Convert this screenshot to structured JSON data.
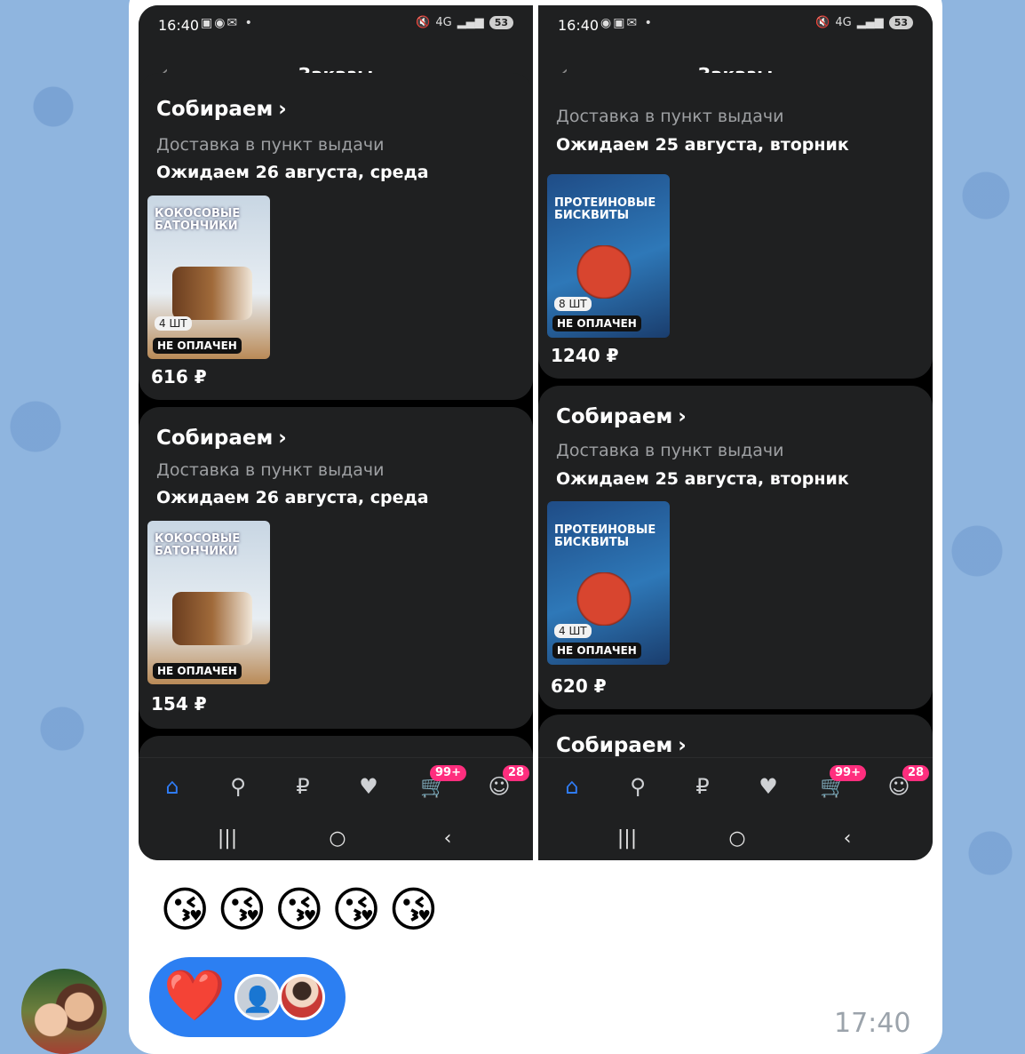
{
  "message": {
    "time": "17:40",
    "emojis": [
      "😘",
      "😘",
      "😘",
      "😘",
      "😘"
    ],
    "reaction": {
      "emoji": "❤️"
    }
  },
  "screens": [
    {
      "status": {
        "time": "16:40",
        "network": "4G",
        "battery": "53"
      },
      "header": {
        "title": "Заказы"
      },
      "orders": [
        {
          "status": "Собираем",
          "delivery": "Доставка в пункт выдачи",
          "date": "Ожидаем 26 августа, среда",
          "product": "КОКОСОВЫЕ БАТОНЧИКИ",
          "qty": "4 ШТ",
          "payment": "НЕ ОПЛАЧЕН",
          "price": "616 ₽"
        },
        {
          "status": "Собираем",
          "delivery": "Доставка в пункт выдачи",
          "date": "Ожидаем 26 августа, среда",
          "product": "КОКОСОВЫЕ БАТОНЧИКИ",
          "qty": "",
          "payment": "НЕ ОПЛАЧЕН",
          "price": "154 ₽"
        }
      ],
      "nav": {
        "cart_badge": "99+",
        "profile_badge": "28"
      }
    },
    {
      "status": {
        "time": "16:40",
        "network": "4G",
        "battery": "53"
      },
      "header": {
        "title": "Заказы"
      },
      "orders": [
        {
          "status": "",
          "delivery": "Доставка в пункт выдачи",
          "date": "Ожидаем 25 августа, вторник",
          "product": "ПРОТЕИНОВЫЕ БИСКВИТЫ",
          "qty": "8 ШТ",
          "payment": "НЕ ОПЛАЧЕН",
          "price": "1240 ₽"
        },
        {
          "status": "Собираем",
          "delivery": "Доставка в пункт выдачи",
          "date": "Ожидаем 25 августа, вторник",
          "product": "ПРОТЕИНОВЫЕ БИСКВИТЫ",
          "qty": "4 ШТ",
          "payment": "НЕ ОПЛАЧЕН",
          "price": "620 ₽"
        },
        {
          "status": "Собираем"
        }
      ],
      "nav": {
        "cart_badge": "99+",
        "profile_badge": "28"
      }
    }
  ],
  "icons": {
    "home": "home-icon",
    "search": "search-icon",
    "ruble": "ruble-icon",
    "favorites": "heart-icon",
    "cart": "cart-icon",
    "profile": "profile-icon"
  },
  "colors": {
    "accent": "#2f7cf6",
    "badge": "#ff2e7e",
    "card": "#1f2021",
    "reaction_pill": "#2c7ff2"
  }
}
